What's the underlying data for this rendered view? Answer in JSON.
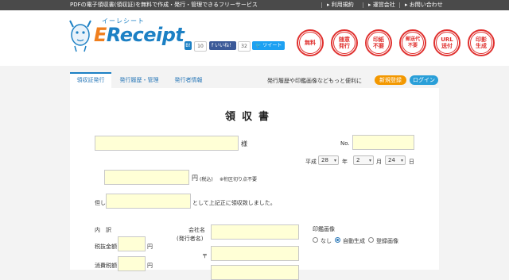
{
  "topbar": {
    "tagline": "PDFの電子領収書(領収証)を無料で作成・発行・管理できるフリーサービス",
    "links": [
      "利用規約",
      "運営会社",
      "お問い合わせ"
    ]
  },
  "logo": {
    "kana": "イーレシート",
    "word_e": "E",
    "word_rest": "Receipt"
  },
  "share": {
    "hatena_count": "10",
    "fb_label": "いいね！",
    "fb_count": "32",
    "tweet_label": "ツイート"
  },
  "seals": [
    {
      "line1": "無料",
      "line2": ""
    },
    {
      "line1": "随意",
      "line2": "発行"
    },
    {
      "line1": "印紙",
      "line2": "不要"
    },
    {
      "line1": "郵送代",
      "line2": "不要"
    },
    {
      "line1": "URL",
      "line2": "送付"
    },
    {
      "line1": "印影",
      "line2": "生成"
    }
  ],
  "nav": {
    "tabs": [
      "領収証発行",
      "発行履歴・管理",
      "発行者情報"
    ],
    "hint": "発行履歴や印鑑画像などもっと便利に",
    "register": "新規登録",
    "login": "ログイン"
  },
  "form": {
    "title": "領収書",
    "sama": "様",
    "no_label": "No.",
    "heisei_label": "平成",
    "year_value": "28",
    "year_label": "年",
    "month_value": "2",
    "month_label": "月",
    "day_value": "24",
    "day_label": "日",
    "yen_label": "円",
    "tax_note": "(税込)",
    "comma_note": "※桁区切り点不要",
    "tadashi": "但し",
    "receipt_text": "として上記正に領収致しました。",
    "breakdown_label": "内　訳",
    "taxfree_label": "税抜金額",
    "tax_label": "消費税額",
    "yen_unit": "円",
    "company_label": "会社名",
    "issuer_label": "(発行者名)",
    "postal_label": "〒",
    "seal_image_label": "印鑑画像",
    "seal_options": [
      "なし",
      "自動生成",
      "登録画像"
    ],
    "seal_selected": 1
  },
  "colors": {
    "brand": "#1c80c4",
    "accent_orange": "#f39800",
    "seal_red": "#e0312f",
    "field_yellow": "#ffffd6"
  }
}
